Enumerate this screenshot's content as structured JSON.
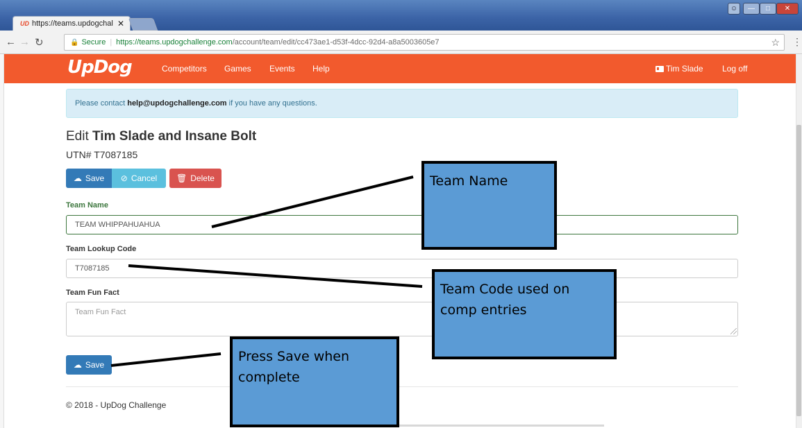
{
  "browser": {
    "tab_title": "https://teams.updogchal",
    "tab_favicon": "UD",
    "tab_close": "✕",
    "omnibox_secure": "Secure",
    "omnibox_host": "https://teams.updogchallenge.com",
    "omnibox_path": "/account/team/edit/cc473ae1-d53f-4dcc-92d4-a8a5003605e7"
  },
  "site_nav": {
    "logo": "UpDog",
    "links": [
      "Competitors",
      "Games",
      "Events",
      "Help"
    ],
    "user": "Tim Slade",
    "logoff": "Log off",
    "brand_color": "#f25a2d"
  },
  "alert": {
    "prefix": "Please contact ",
    "email": "help@updogchallenge.com",
    "suffix": " if you have any questions."
  },
  "page": {
    "edit_prefix": "Edit ",
    "team_title": "Tim Slade and Insane Bolt",
    "utn": "UTN# T7087185"
  },
  "buttons": {
    "save": "Save",
    "cancel": "Cancel",
    "delete": "Delete"
  },
  "form": {
    "team_name_label": "Team Name",
    "team_name_value": "TEAM WHIPPAHUAHUA",
    "lookup_label": "Team Lookup Code",
    "lookup_value": "T7087185",
    "fun_fact_label": "Team Fun Fact",
    "fun_fact_placeholder": "Team Fun Fact"
  },
  "footer": "© 2018 - UpDog Challenge",
  "callouts": {
    "team_name": "Team Name",
    "team_code": "Team Code used on comp entries",
    "press_save": "Press Save when complete"
  }
}
